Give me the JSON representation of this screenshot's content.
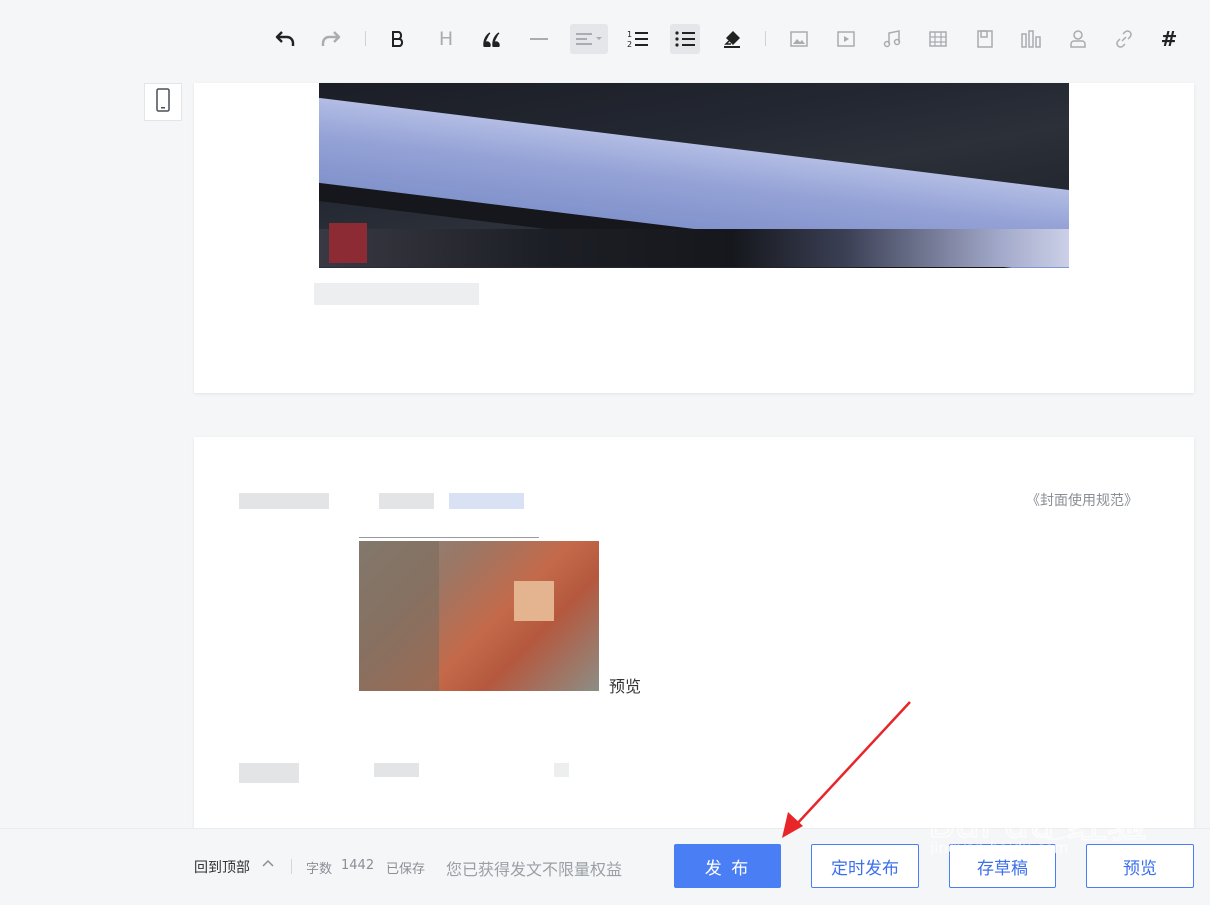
{
  "toolbar": {
    "heading_label": "H",
    "tag_label": "#"
  },
  "editor": {
    "cover_rules_link": "《封面使用规范》",
    "cover_preview_label": "预览"
  },
  "bottom_bar": {
    "back_to_top": "回到顶部",
    "word_count_label": "字数",
    "word_count": "1442",
    "saved_status": "已保存",
    "benefit_text": "您已获得发文不限量权益",
    "publish_button": "发 布",
    "schedule_button": "定时发布",
    "draft_button": "存草稿",
    "preview_button": "预览"
  },
  "watermark": {
    "text": "Bai du 经验",
    "domain": "jingyan.baidu.com"
  },
  "colors": {
    "accent": "#4a7ef5",
    "annotation": "#e8262a"
  }
}
